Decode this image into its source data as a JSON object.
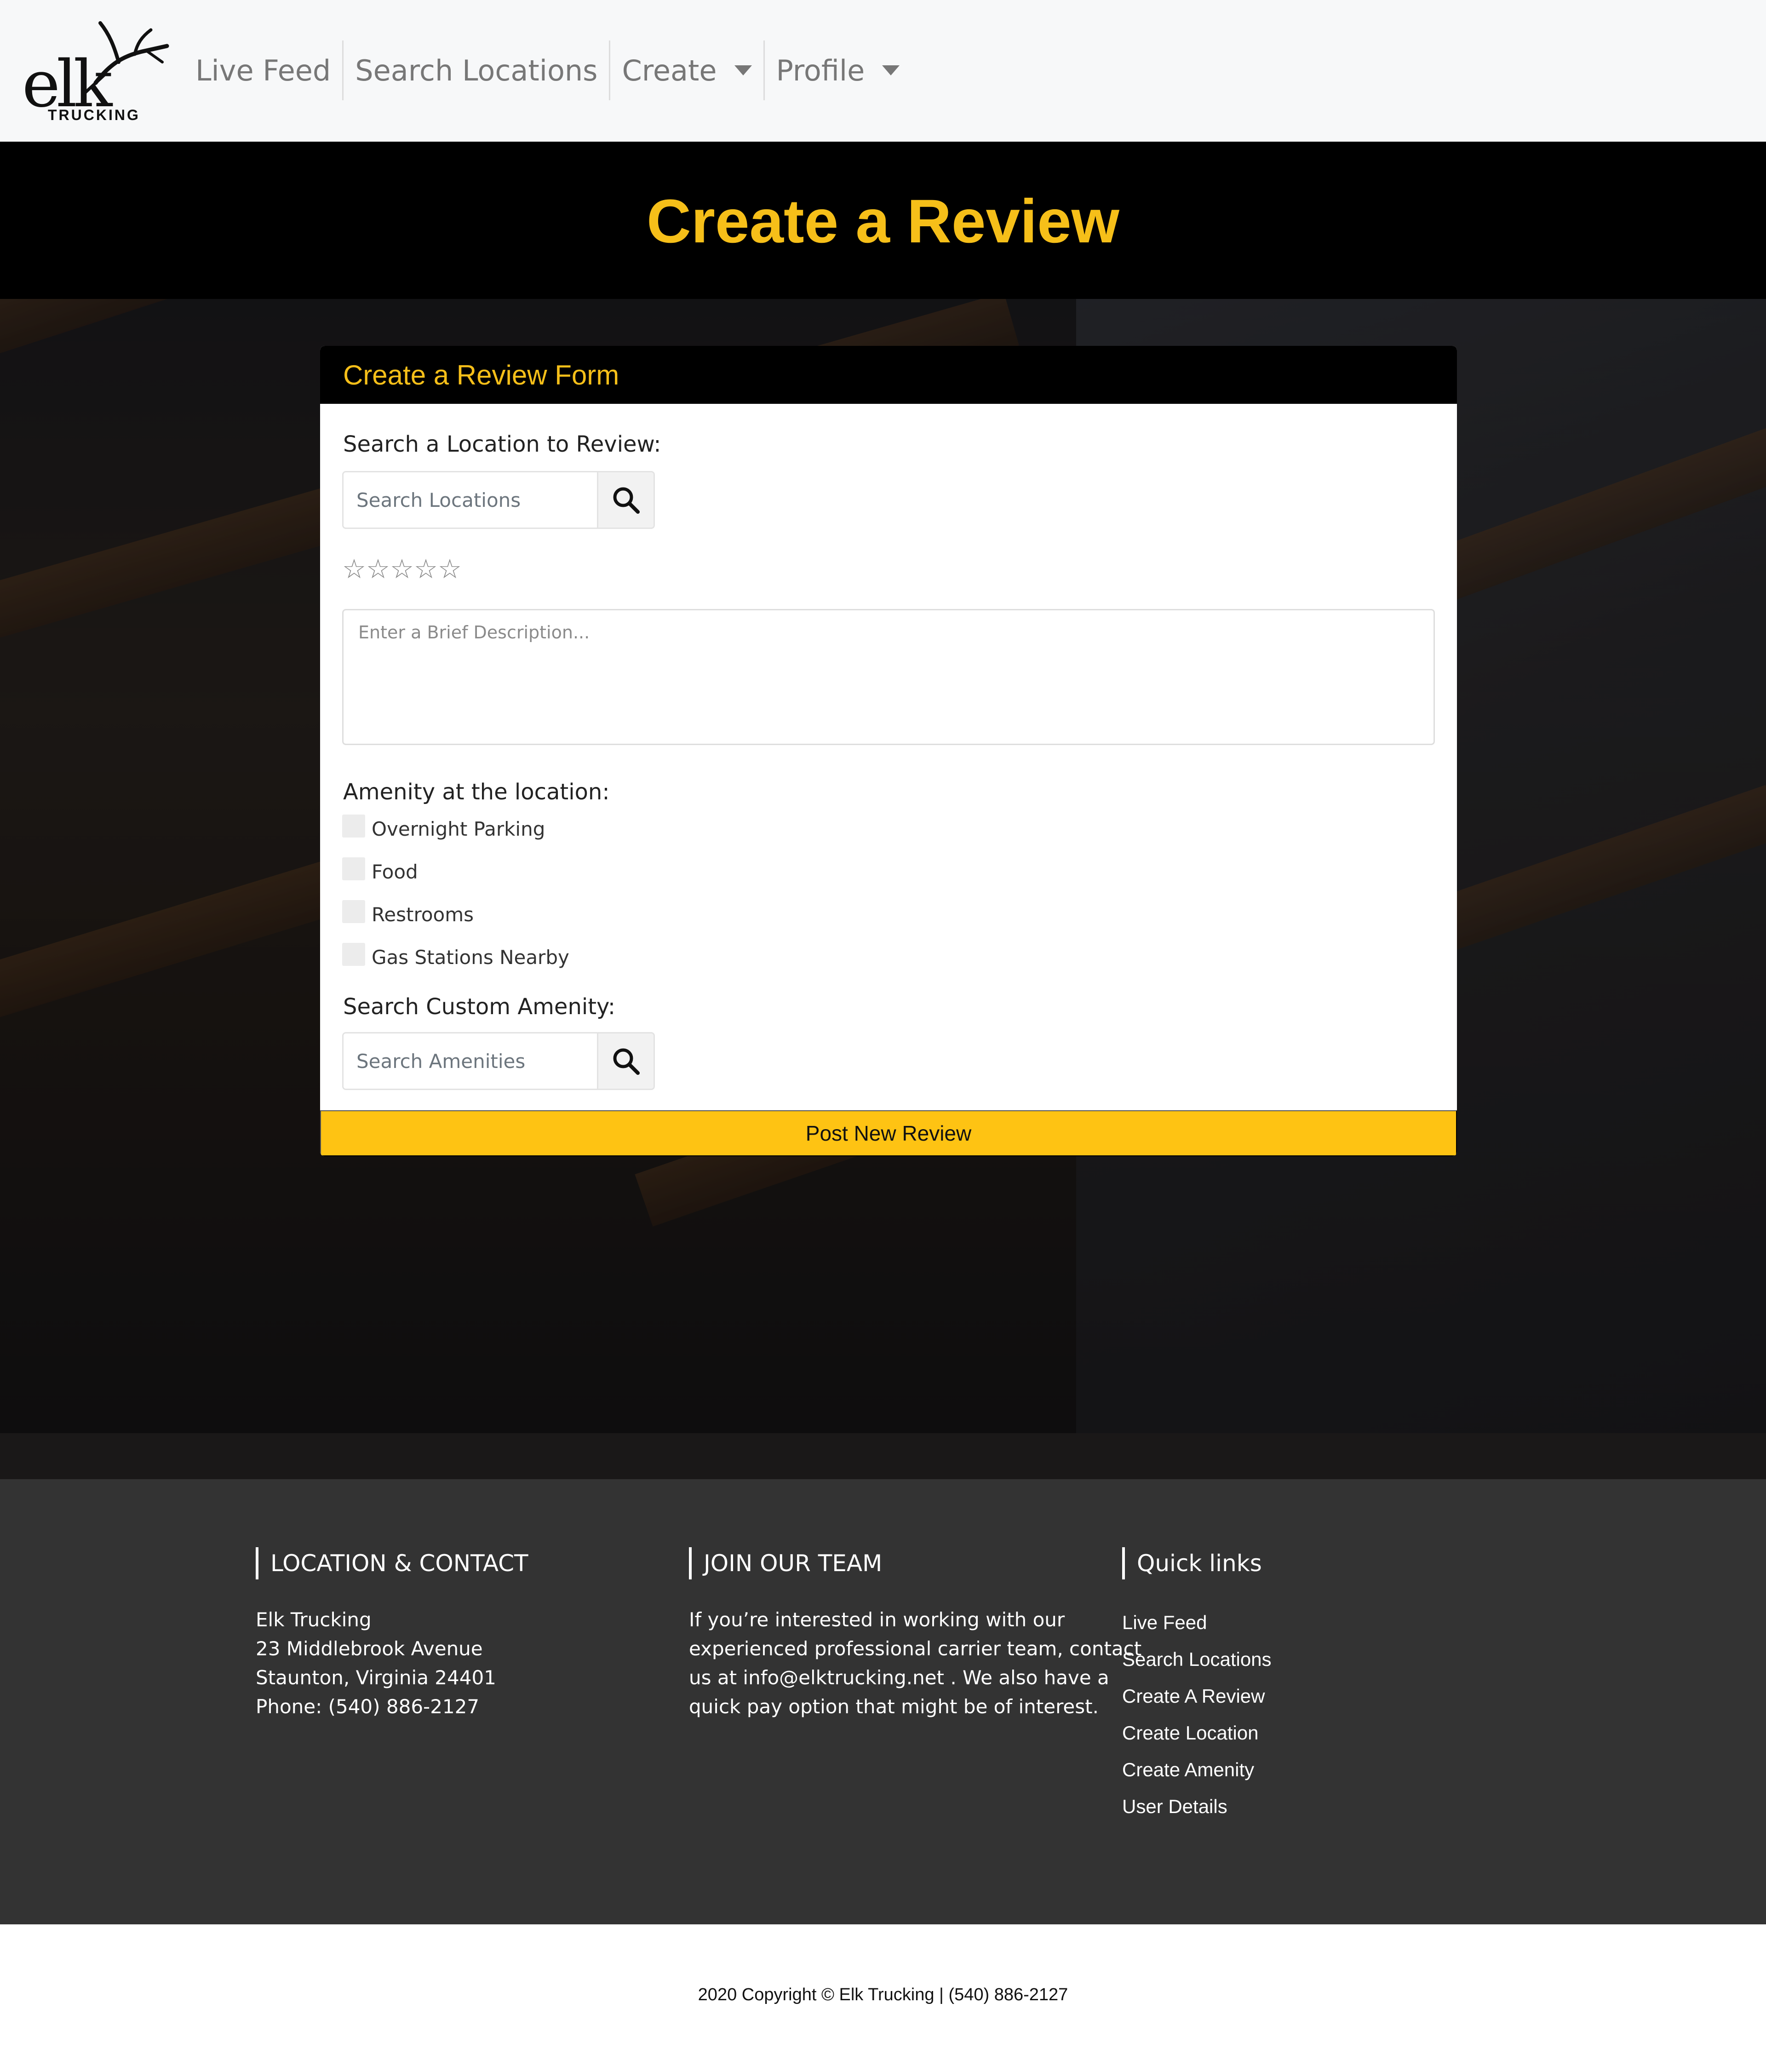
{
  "logo": {
    "text": "elk",
    "sub": "TRUCKING"
  },
  "nav": {
    "live_feed": "Live Feed",
    "search_locations": "Search Locations",
    "create": "Create",
    "profile": "Profile"
  },
  "hero": {
    "title": "Create a Review"
  },
  "form": {
    "header": "Create a Review Form",
    "location_label": "Search a Location to Review:",
    "location_placeholder": "Search Locations",
    "rating": {
      "stars": "☆☆☆☆☆",
      "value": 0,
      "max": 5
    },
    "description_placeholder": "Enter a Brief Description...",
    "amenity_label": "Amenity at the location:",
    "amenities": [
      "Overnight Parking",
      "Food",
      "Restrooms",
      "Gas Stations Nearby"
    ],
    "custom_label": "Search Custom Amenity:",
    "custom_placeholder": "Search Amenities",
    "submit": "Post New Review"
  },
  "footer": {
    "contact": {
      "title": "LOCATION & CONTACT",
      "lines": [
        "Elk Trucking",
        "23 Middlebrook Avenue",
        "Staunton, Virginia 24401",
        "Phone: (540) 886-2127"
      ]
    },
    "join": {
      "title": "JOIN OUR TEAM",
      "lines": [
        "If you’re interested in working with our",
        "experienced professional carrier team, contact",
        "us at info@elktrucking.net . We also have a",
        "quick pay option that might be of interest."
      ]
    },
    "links": {
      "title": "Quick links",
      "items": [
        "Live Feed",
        "Search Locations",
        "Create A Review",
        "Create Location",
        "Create Amenity",
        "User Details"
      ]
    },
    "copyright": "2020 Copyright © Elk Trucking | (540) 886-2127"
  },
  "colors": {
    "accent": "#f6bf19",
    "button": "#fec313",
    "footer_bg": "#333333"
  }
}
